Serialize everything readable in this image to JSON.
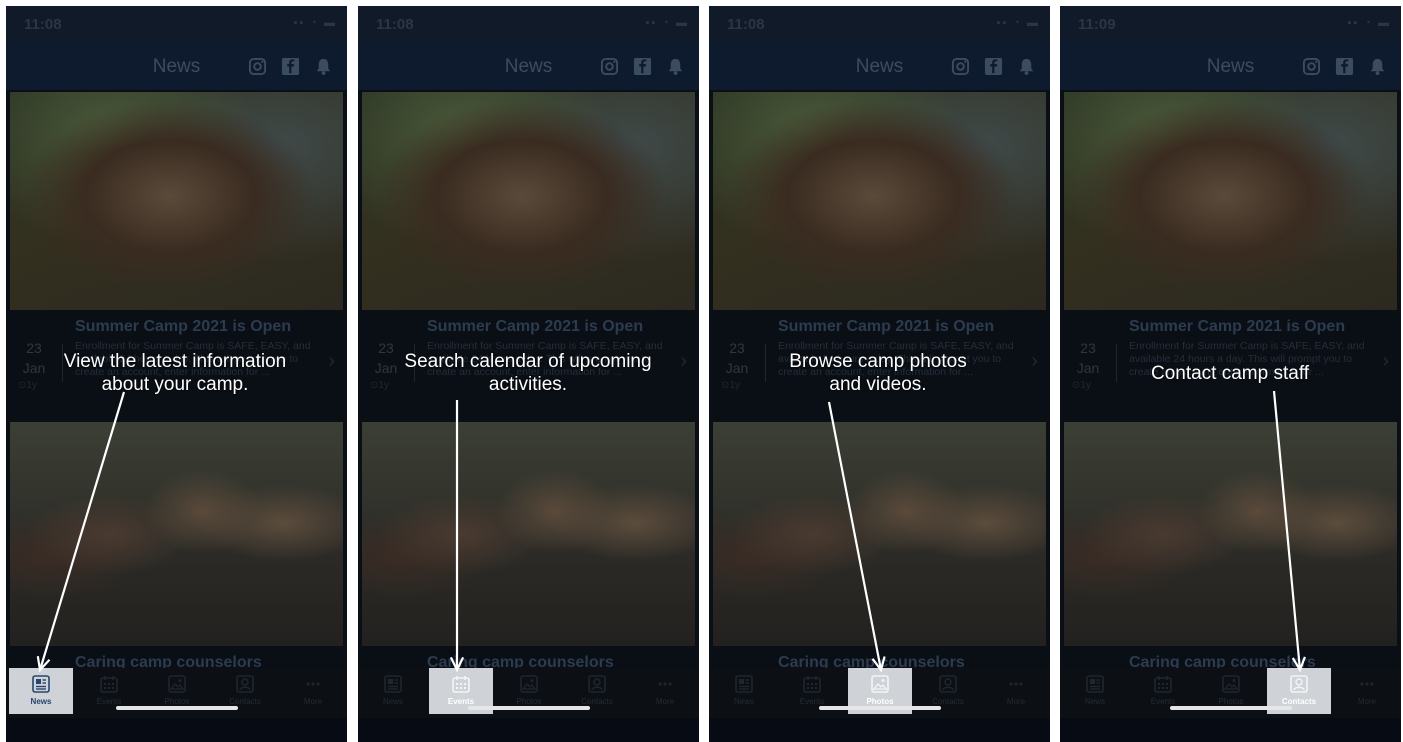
{
  "colors": {
    "overlay_caption": "#ffffff",
    "active_tab_bg": "#cfd3d8",
    "nav_bg": "#0e1b2e"
  },
  "panels": [
    {
      "status": {
        "time": "11:08"
      },
      "nav": {
        "title": "News",
        "icons": [
          "instagram-icon",
          "facebook-icon",
          "bell-icon"
        ]
      },
      "card1": {
        "title": "Summer Camp 2021 is Open",
        "day": "23",
        "month": "Jan",
        "ago": "⊙1y",
        "text": "Enrollment for Summer Camp is SAFE, EASY, and available 24 hours a day. This will prompt you to create an account, enter information for ..."
      },
      "card2": {
        "title": "Caring camp counselors"
      },
      "tabs": [
        {
          "label": "News",
          "icon": "news-icon",
          "active": true
        },
        {
          "label": "Events",
          "icon": "calendar-icon",
          "active": false
        },
        {
          "label": "Photos",
          "icon": "photos-icon",
          "active": false
        },
        {
          "label": "Contacts",
          "icon": "contacts-icon",
          "active": false
        },
        {
          "label": "More",
          "icon": "more-icon",
          "active": false
        }
      ],
      "caption": "View the latest information\nabout your camp."
    },
    {
      "status": {
        "time": "11:08"
      },
      "nav": {
        "title": "News",
        "icons": [
          "instagram-icon",
          "facebook-icon",
          "bell-icon"
        ]
      },
      "card1": {
        "title": "Summer Camp 2021 is Open",
        "day": "23",
        "month": "Jan",
        "ago": "⊙1y",
        "text": "Enrollment for Summer Camp is SAFE, EASY, and available 24 hours a day. This will prompt you to create an account, enter information for ..."
      },
      "card2": {
        "title": "Caring camp counselors"
      },
      "tabs": [
        {
          "label": "News",
          "icon": "news-icon",
          "active": false
        },
        {
          "label": "Events",
          "icon": "calendar-icon",
          "active": true
        },
        {
          "label": "Photos",
          "icon": "photos-icon",
          "active": false
        },
        {
          "label": "Contacts",
          "icon": "contacts-icon",
          "active": false
        },
        {
          "label": "More",
          "icon": "more-icon",
          "active": false
        }
      ],
      "caption": "Search calendar of upcoming\nactivities."
    },
    {
      "status": {
        "time": "11:08"
      },
      "nav": {
        "title": "News",
        "icons": [
          "instagram-icon",
          "facebook-icon",
          "bell-icon"
        ]
      },
      "card1": {
        "title": "Summer Camp 2021 is Open",
        "day": "23",
        "month": "Jan",
        "ago": "⊙1y",
        "text": "Enrollment for Summer Camp is SAFE, EASY, and available 24 hours a day. This will prompt you to create an account, enter information for ..."
      },
      "card2": {
        "title": "Caring camp counselors"
      },
      "tabs": [
        {
          "label": "News",
          "icon": "news-icon",
          "active": false
        },
        {
          "label": "Events",
          "icon": "calendar-icon",
          "active": false
        },
        {
          "label": "Photos",
          "icon": "photos-icon",
          "active": true
        },
        {
          "label": "Contacts",
          "icon": "contacts-icon",
          "active": false
        },
        {
          "label": "More",
          "icon": "more-icon",
          "active": false
        }
      ],
      "caption": "Browse camp photos\nand videos."
    },
    {
      "status": {
        "time": "11:09"
      },
      "nav": {
        "title": "News",
        "icons": [
          "instagram-icon",
          "facebook-icon",
          "bell-icon"
        ]
      },
      "card1": {
        "title": "Summer Camp 2021 is Open",
        "day": "23",
        "month": "Jan",
        "ago": "⊙1y",
        "text": "Enrollment for Summer Camp is SAFE, EASY, and available 24 hours a day. This will prompt you to create an account, enter information for ..."
      },
      "card2": {
        "title": "Caring camp counselors"
      },
      "tabs": [
        {
          "label": "News",
          "icon": "news-icon",
          "active": false
        },
        {
          "label": "Events",
          "icon": "calendar-icon",
          "active": false
        },
        {
          "label": "Photos",
          "icon": "photos-icon",
          "active": false
        },
        {
          "label": "Contacts",
          "icon": "contacts-icon",
          "active": true
        },
        {
          "label": "More",
          "icon": "more-icon",
          "active": false
        }
      ],
      "caption": "Contact camp staff"
    }
  ]
}
